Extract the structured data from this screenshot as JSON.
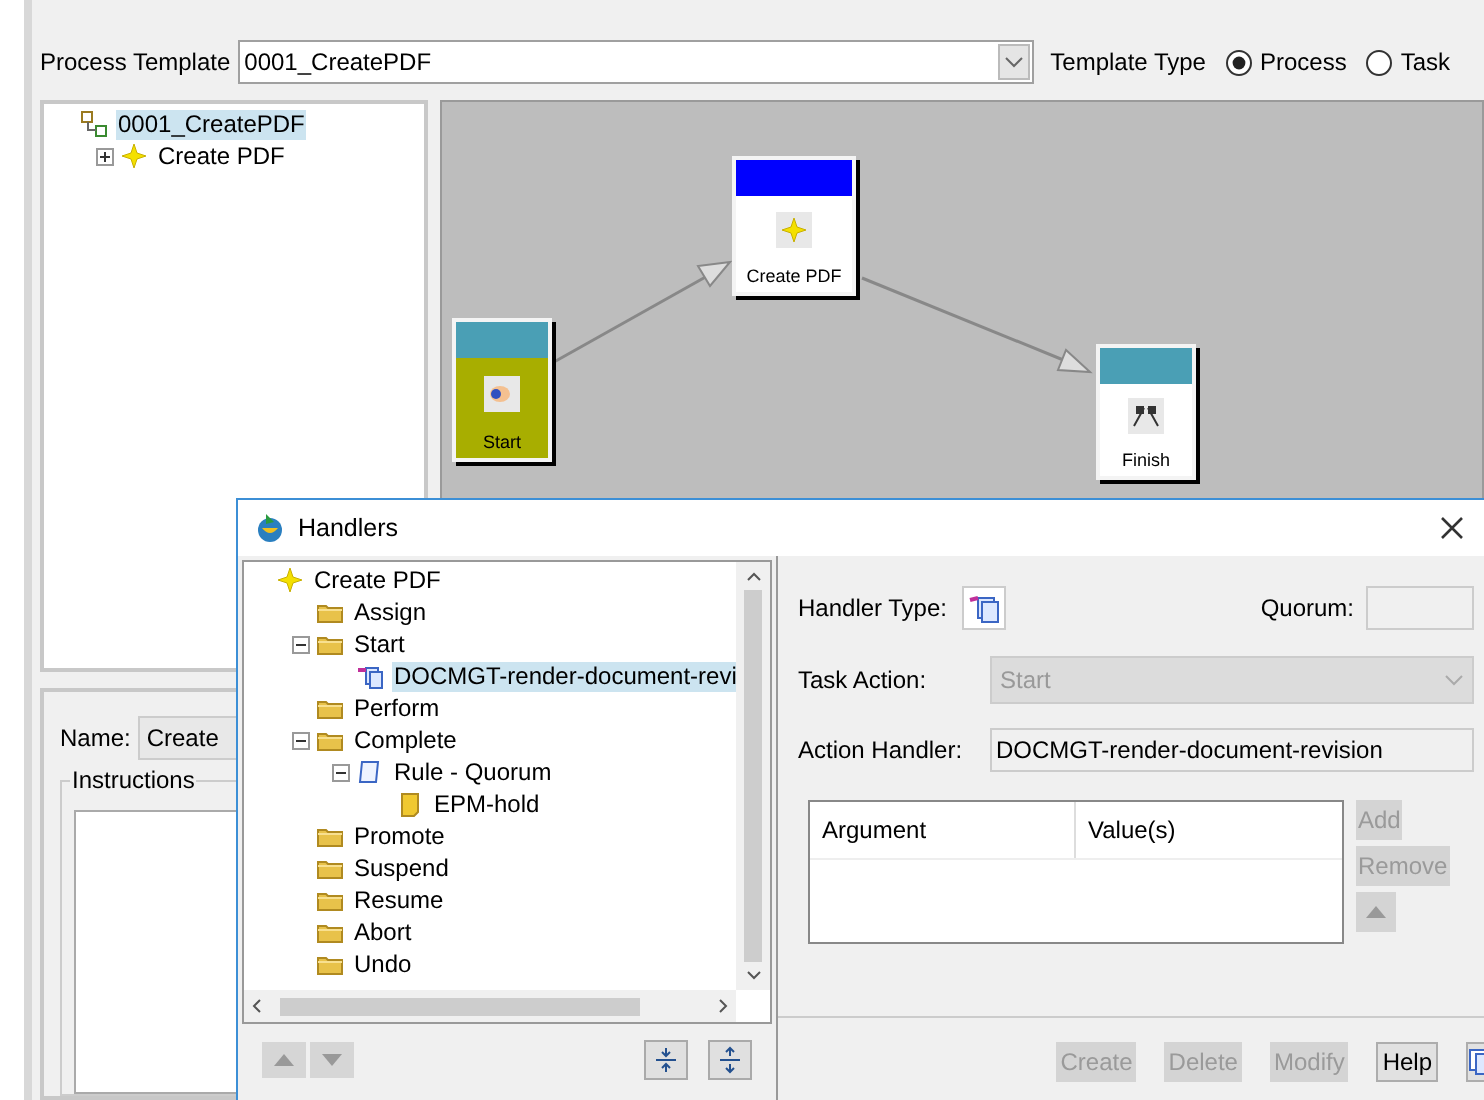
{
  "process_template": {
    "label": "Process Template",
    "value": "0001_CreatePDF"
  },
  "template_type": {
    "label": "Template Type",
    "options": [
      {
        "label": "Process",
        "selected": true
      },
      {
        "label": "Task",
        "selected": false
      }
    ]
  },
  "template_tree": [
    {
      "label": "0001_CreatePDF",
      "kind": "process",
      "selected": true,
      "children": [
        {
          "label": "Create PDF",
          "kind": "task",
          "selected": false,
          "expanded": false
        }
      ]
    }
  ],
  "canvas": {
    "nodes": [
      {
        "label": "Start",
        "kind": "start",
        "color": "#4a9fb5"
      },
      {
        "label": "Create PDF",
        "kind": "task",
        "color": "#0000ff"
      },
      {
        "label": "Finish",
        "kind": "finish",
        "color": "#4a9fb5"
      }
    ]
  },
  "name_field": {
    "label": "Name:",
    "value": "Create"
  },
  "instructions": {
    "label": "Instructions"
  },
  "handlers_dialog": {
    "title": "Handlers",
    "tree": [
      {
        "label": "Create PDF",
        "kind": "task",
        "selected": false,
        "children": [
          {
            "label": "Assign",
            "kind": "folder",
            "selected": false
          },
          {
            "label": "Start",
            "kind": "folder",
            "selected": false,
            "expanded": true,
            "children": [
              {
                "label": "DOCMGT-render-document-revi",
                "kind": "handler",
                "selected": true
              }
            ]
          },
          {
            "label": "Perform",
            "kind": "folder",
            "selected": false
          },
          {
            "label": "Complete",
            "kind": "folder",
            "selected": false,
            "expanded": true,
            "children": [
              {
                "label": "Rule - Quorum",
                "kind": "rule",
                "selected": false,
                "expanded": true,
                "children": [
                  {
                    "label": "EPM-hold",
                    "kind": "rule_handler",
                    "selected": false
                  }
                ]
              }
            ]
          },
          {
            "label": "Promote",
            "kind": "folder",
            "selected": false
          },
          {
            "label": "Suspend",
            "kind": "folder",
            "selected": false
          },
          {
            "label": "Resume",
            "kind": "folder",
            "selected": false
          },
          {
            "label": "Abort",
            "kind": "folder",
            "selected": false
          },
          {
            "label": "Undo",
            "kind": "folder",
            "selected": false
          }
        ]
      }
    ],
    "handler_type": {
      "label": "Handler Type:"
    },
    "quorum": {
      "label": "Quorum:"
    },
    "task_action": {
      "label": "Task Action:",
      "value": "Start",
      "disabled": true
    },
    "action_handler": {
      "label": "Action Handler:",
      "value": "DOCMGT-render-document-revision"
    },
    "arguments_table": {
      "columns": [
        "Argument",
        "Value(s)"
      ]
    },
    "side_buttons": [
      {
        "label": "Add",
        "disabled": true
      },
      {
        "label": "Remove",
        "disabled": true
      }
    ],
    "buttons": [
      {
        "label": "Create",
        "disabled": true
      },
      {
        "label": "Delete",
        "disabled": true
      },
      {
        "label": "Modify",
        "disabled": true
      },
      {
        "label": "Help",
        "disabled": false
      }
    ]
  }
}
